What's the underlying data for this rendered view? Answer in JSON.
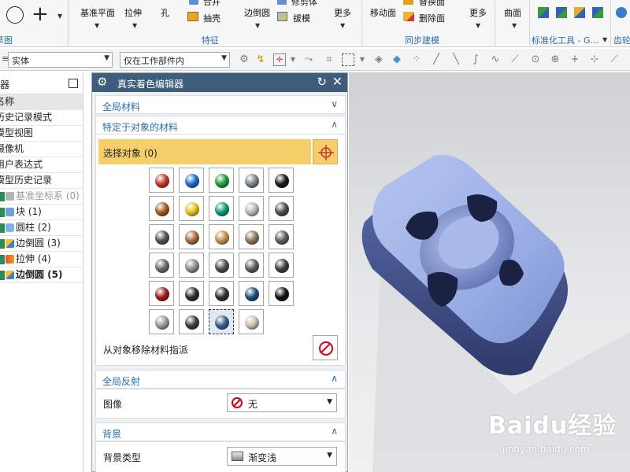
{
  "ribbon": {
    "items": {
      "datum_plane": "基准平面",
      "extrude": "拉伸",
      "hole": "孔",
      "unite": "合并",
      "shell": "抽壳",
      "edge_blend": "边倒圆",
      "trim_body": "修剪体",
      "draft": "拔模",
      "more1": "更多",
      "move_face": "移动面",
      "replace_face": "替换面",
      "delete_face": "删除面",
      "more2": "更多",
      "surface": "曲面"
    },
    "groups": {
      "sketch": "草图",
      "feature": "特征",
      "sync_modeling": "同步建模",
      "standard_tools": "标准化工具 - G...",
      "gear": "齿轮"
    }
  },
  "toolbar2": {
    "type_filter": "实体",
    "scope_filter": "仅在工作部件内"
  },
  "navigator": {
    "title": "导航器",
    "rows": [
      {
        "label": "名称",
        "cls": "sel"
      },
      {
        "label": "历史记录模式",
        "cls": ""
      },
      {
        "label": "模型视图",
        "cls": ""
      },
      {
        "label": "摄像机",
        "cls": ""
      },
      {
        "label": "用户表达式",
        "cls": ""
      },
      {
        "label": "模型历史记录",
        "cls": ""
      },
      {
        "label": "基准坐标系 (0)",
        "cls": "dim",
        "icon": "ico-csys"
      },
      {
        "label": "块 (1)",
        "cls": "",
        "icon": "ico-block"
      },
      {
        "label": "圆柱 (2)",
        "cls": "",
        "icon": "ico-cyl"
      },
      {
        "label": "边倒圆 (3)",
        "cls": "",
        "icon": "ico-blend"
      },
      {
        "label": "拉伸 (4)",
        "cls": "",
        "icon": "ico-ext"
      },
      {
        "label": "边倒圆 (5)",
        "cls": "bold",
        "icon": "ico-blend"
      }
    ]
  },
  "dialog": {
    "title": "真实着色编辑器",
    "global_material": "全局材料",
    "object_material": "特定于对象的材料",
    "select_object": "选择对象 (0)",
    "remove_assignment": "从对象移除材料指派",
    "global_reflection": "全局反射",
    "image_label": "图像",
    "image_value": "无",
    "background": "背景",
    "background_type_label": "背景类型",
    "background_type_value": "渐变浅"
  },
  "materials": [
    [
      "#c0392b",
      "#1f6fc5",
      "#1e9c3a",
      "#7d8387",
      "#1b1b1b"
    ],
    [
      "#a65a1d",
      "#e5c21c",
      "#0e9a7a",
      "#b8b8b8",
      "#4a4f55"
    ],
    [
      "#505459",
      "#a86a3a",
      "#c2914e",
      "#8a7a5a",
      "#5e5e5e"
    ],
    [
      "#6a6d72",
      "#8d8d8d",
      "#4e4e4e",
      "#5a5f66",
      "#3b3f45"
    ],
    [
      "#9c1c1c",
      "#2b2e31",
      "#2d3237",
      "#1f4f7a",
      "#101010"
    ],
    [
      "#9a9a9a",
      "#3e3e3e",
      "#3b5e8c",
      "#c9bfa8"
    ]
  ],
  "selected_material": [
    5,
    2
  ],
  "watermark": {
    "brand": "Baidu经验",
    "url": "jingyan.baidu.com"
  }
}
